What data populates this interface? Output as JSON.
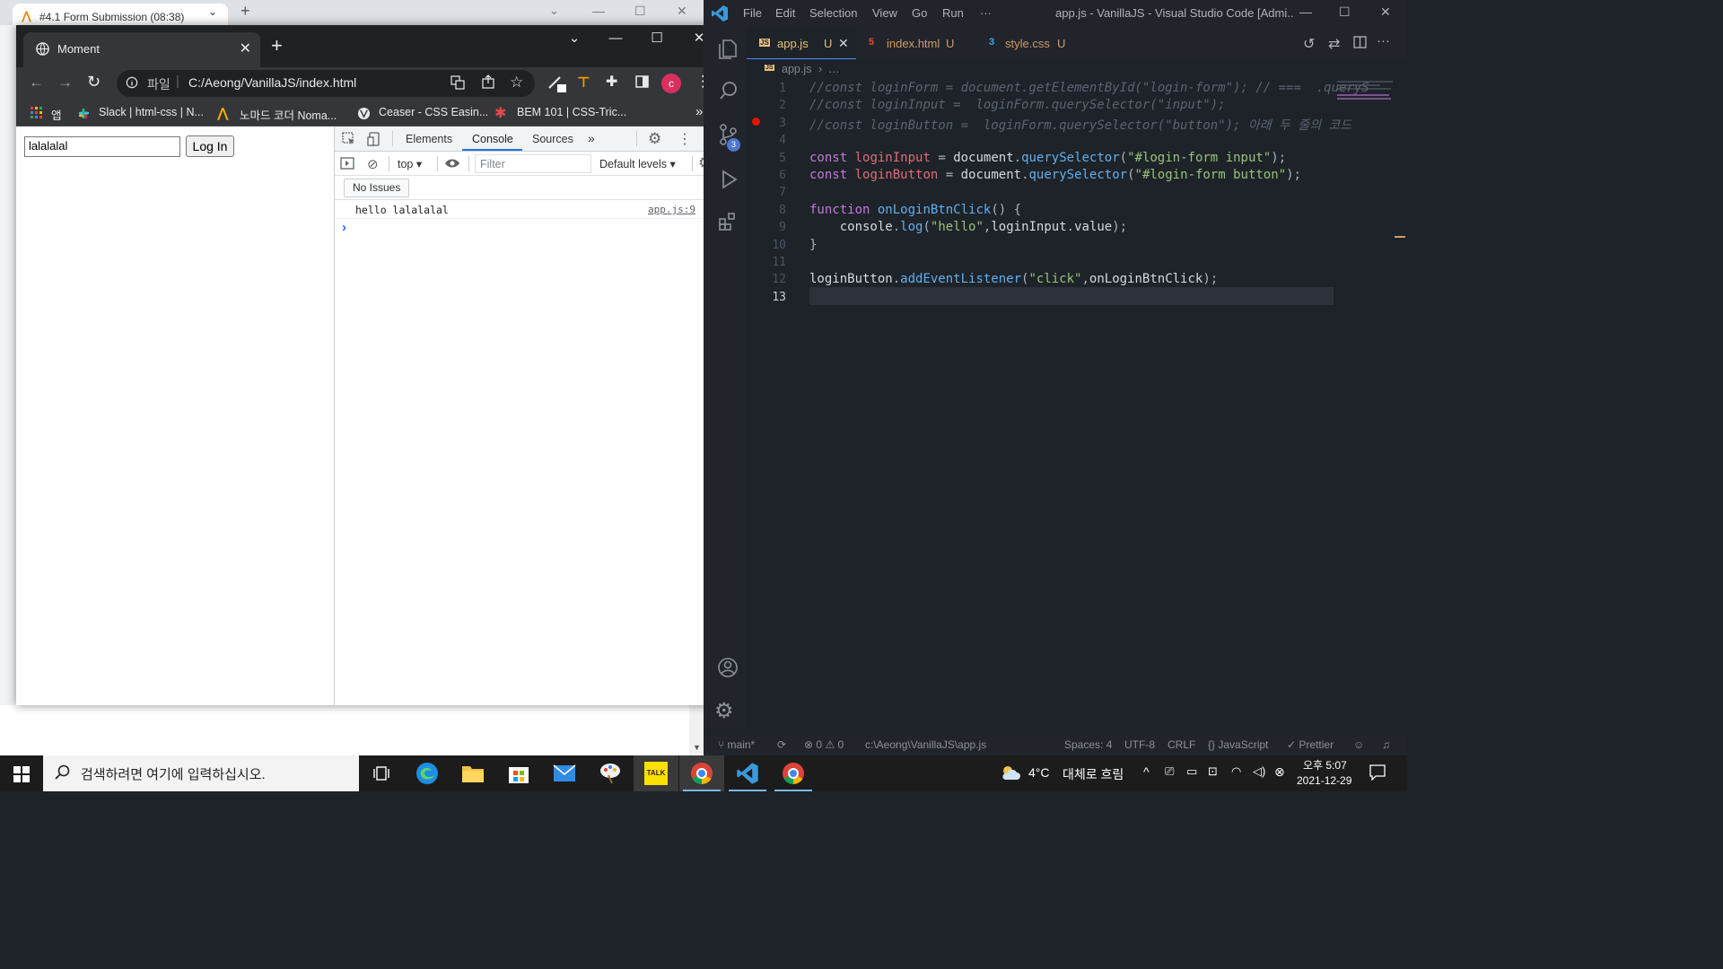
{
  "bg_browser": {
    "tab_title": "#4.1 Form Submission (08:38)"
  },
  "chrome": {
    "tab_title": "Moment",
    "url_prefix": "파일",
    "url": "C:/Aeong/VanillaJS/index.html",
    "profile_initial": "c",
    "bookmarks": [
      {
        "label": "앱"
      },
      {
        "label": "Slack | html-css | N..."
      },
      {
        "label": "노마드 코더 Noma..."
      },
      {
        "label": "Ceaser - CSS Easin..."
      },
      {
        "label": "BEM 101 | CSS-Tric..."
      }
    ],
    "bookmarks_more": "»",
    "page": {
      "input_value": "lalalalal",
      "button_label": "Log In"
    }
  },
  "devtools": {
    "tabs": [
      "Elements",
      "Console",
      "Sources"
    ],
    "more_tabs": "»",
    "context": "top",
    "filter_placeholder": "Filter",
    "levels": "Default levels",
    "issues": "No Issues",
    "log_message": "hello lalalalal",
    "log_source": "app.js:9",
    "prompt": "›"
  },
  "vscode": {
    "menu": [
      "File",
      "Edit",
      "Selection",
      "View",
      "Go",
      "Run",
      "···"
    ],
    "title": "app.js - VanillaJS - Visual Studio Code [Admi...",
    "tabs": [
      {
        "label": "app.js",
        "status": "U",
        "icon": "JS"
      },
      {
        "label": "index.html",
        "status": "U",
        "icon": "5"
      },
      {
        "label": "style.css",
        "status": "U",
        "icon": "3"
      }
    ],
    "breadcrumb": "app.js",
    "breadcrumb_more": "…",
    "scm_badge": "3",
    "code": [
      {
        "n": "1",
        "text": "//const loginForm = document.getElementById(\"login-form\"); // ===  .queryS"
      },
      {
        "n": "2",
        "text": "//const loginInput =  loginForm.querySelector(\"input\");"
      },
      {
        "n": "3",
        "text": "//const loginButton =  loginForm.querySelector(\"button\"); 아래 두 줄의 코드"
      },
      {
        "n": "4",
        "text": ""
      },
      {
        "n": "5",
        "text": "const loginInput = document.querySelector(\"#login-form input\");"
      },
      {
        "n": "6",
        "text": "const loginButton = document.querySelector(\"#login-form button\");"
      },
      {
        "n": "7",
        "text": ""
      },
      {
        "n": "8",
        "text": "function onLoginBtnClick() {"
      },
      {
        "n": "9",
        "text": "    console.log(\"hello\",loginInput.value);"
      },
      {
        "n": "10",
        "text": "}"
      },
      {
        "n": "11",
        "text": ""
      },
      {
        "n": "12",
        "text": "loginButton.addEventListener(\"click\",onLoginBtnClick);"
      },
      {
        "n": "13",
        "text": ""
      }
    ],
    "status": {
      "branch": "main*",
      "errors": "0",
      "warnings": "0",
      "path": "c:\\Aeong\\VanillaJS\\app.js",
      "spaces": "Spaces: 4",
      "encoding": "UTF-8",
      "eol": "CRLF",
      "language": "JavaScript",
      "formatter": "Prettier"
    }
  },
  "taskbar": {
    "search_placeholder": "검색하려면 여기에 입력하십시오.",
    "weather_temp": "4°C",
    "weather_text": "대체로 흐림",
    "time": "오후 5:07",
    "date": "2021-12-29",
    "kakao_label": "TALK"
  },
  "colors": {
    "vs_keyword": "#c678dd",
    "vs_string": "#98c379",
    "vs_function": "#61afef",
    "vs_variable": "#e06c75",
    "vs_comment": "#5c6370",
    "chrome_accent": "#1a73e8"
  }
}
